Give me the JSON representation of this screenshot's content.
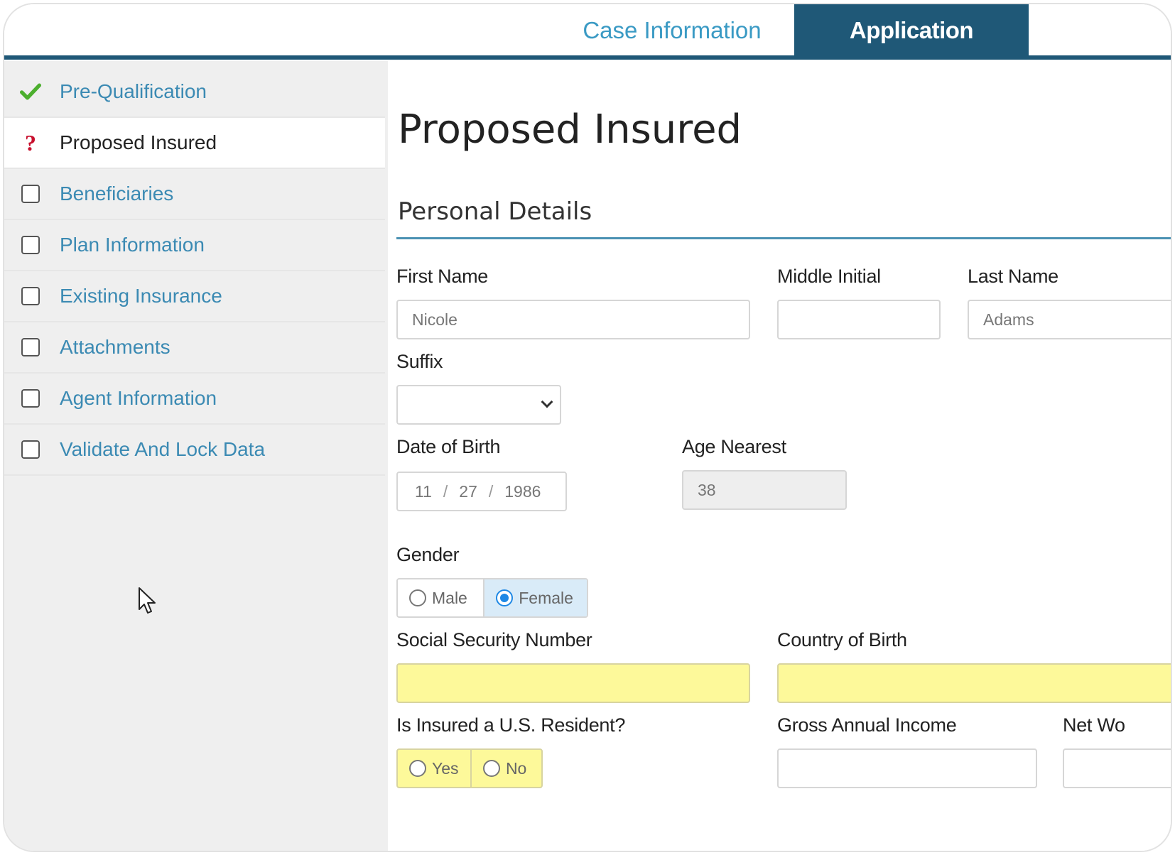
{
  "tabs": {
    "case_information": "Case Information",
    "application": "Application"
  },
  "sidebar": {
    "items": [
      {
        "label": "Pre-Qualification",
        "status": "check-icon"
      },
      {
        "label": "Proposed Insured",
        "status": "question-icon"
      },
      {
        "label": "Beneficiaries",
        "status": "checkbox-icon"
      },
      {
        "label": "Plan Information",
        "status": "checkbox-icon"
      },
      {
        "label": "Existing Insurance",
        "status": "checkbox-icon"
      },
      {
        "label": "Attachments",
        "status": "checkbox-icon"
      },
      {
        "label": "Agent Information",
        "status": "checkbox-icon"
      },
      {
        "label": "Validate And Lock Data",
        "status": "checkbox-icon"
      }
    ]
  },
  "main": {
    "page_title": "Proposed Insured",
    "section_title": "Personal Details",
    "first_name": {
      "label": "First Name",
      "placeholder": "Nicole"
    },
    "middle_initial": {
      "label": "Middle Initial",
      "value": ""
    },
    "last_name": {
      "label": "Last Name",
      "placeholder": "Adams"
    },
    "suffix": {
      "label": "Suffix",
      "value": ""
    },
    "dob": {
      "label": "Date of Birth",
      "month": "11",
      "day": "27",
      "year": "1986",
      "separator": "/"
    },
    "age_nearest": {
      "label": "Age Nearest",
      "value": "38"
    },
    "gender": {
      "label": "Gender",
      "options": [
        "Male",
        "Female"
      ],
      "selected": "Female"
    },
    "ssn": {
      "label": "Social Security Number",
      "value": ""
    },
    "country_of_birth": {
      "label": "Country of Birth",
      "value": ""
    },
    "us_resident": {
      "label": "Is Insured a U.S. Resident?",
      "options": [
        "Yes",
        "No"
      ]
    },
    "gross_income": {
      "label": "Gross Annual Income",
      "value": ""
    },
    "net_worth": {
      "label": "Net Wo",
      "value": ""
    }
  },
  "colors": {
    "primary": "#1f5877",
    "link": "#3b8ab3",
    "required_fill": "#fdf99a",
    "selected_fill": "#d9ebf8",
    "check": "#4caf2e",
    "question": "#c8102e"
  }
}
